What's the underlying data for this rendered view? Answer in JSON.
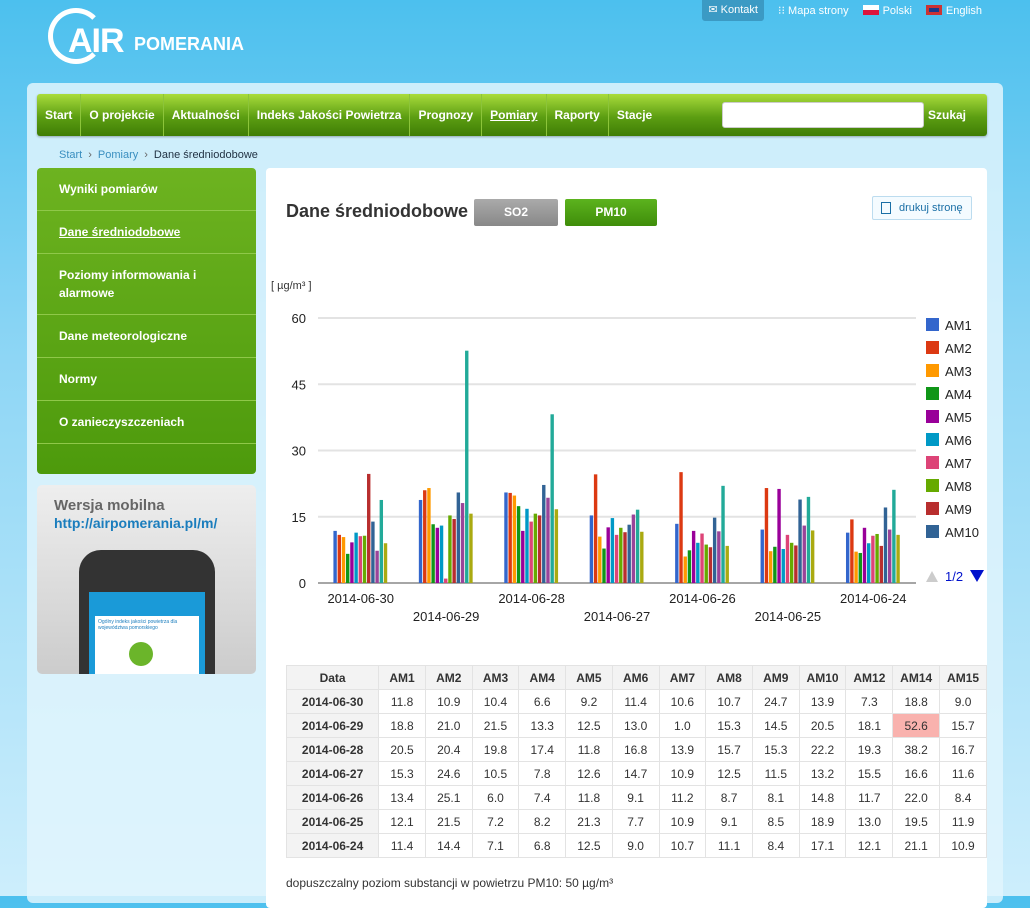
{
  "logo": {
    "text_air": "AIR",
    "text_pomerania": "POMERANIA",
    "reg": "®"
  },
  "toplinks": {
    "kontakt": "Kontakt",
    "mapa": "Mapa strony",
    "polski": "Polski",
    "english": "English"
  },
  "nav": {
    "items": [
      "Start",
      "O projekcie",
      "Aktualności",
      "Indeks Jakości Powietrza",
      "Prognozy",
      "Pomiary",
      "Raporty",
      "Stacje"
    ],
    "active": "Pomiary",
    "search_value": "",
    "search_button": "Szukaj"
  },
  "breadcrumb": [
    "Start",
    "Pomiary",
    "Dane średniodobowe"
  ],
  "sidebar": {
    "items": [
      "Wyniki pomiarów",
      "Dane średniodobowe",
      "Poziomy informowania i alarmowe",
      "Dane meteorologiczne",
      "Normy",
      "O zanieczyszczeniach"
    ],
    "active": "Dane średniodobowe"
  },
  "mobile": {
    "title": "Wersja mobilna",
    "url": "http://airpomerania.pl/m/",
    "screen_text": "Ogólny indeks jakości powietrza dla województwa pomorskiego"
  },
  "main": {
    "title": "Dane średniodobowe",
    "tabs": [
      "SO2",
      "PM10"
    ],
    "active_tab": "PM10",
    "print": "drukuj stronę",
    "unit": "[ µg/m³ ]",
    "note": "dopuszczalny poziom substancji w powietrzu PM10: 50 µg/m³",
    "legend_page": "1/2"
  },
  "chart_data": {
    "type": "bar",
    "ylabel": "[ µg/m³ ]",
    "ylim": [
      0,
      60
    ],
    "yticks": [
      0,
      15,
      30,
      45,
      60
    ],
    "grid": true,
    "legend": "right",
    "categories": [
      "2014-06-30",
      "2014-06-29",
      "2014-06-28",
      "2014-06-27",
      "2014-06-26",
      "2014-06-25",
      "2014-06-24"
    ],
    "series": [
      {
        "name": "AM1",
        "color": "#3366cc",
        "values": [
          11.8,
          18.8,
          20.5,
          15.3,
          13.4,
          12.1,
          11.4
        ]
      },
      {
        "name": "AM2",
        "color": "#dc3912",
        "values": [
          10.9,
          21.0,
          20.4,
          24.6,
          25.1,
          21.5,
          14.4
        ]
      },
      {
        "name": "AM3",
        "color": "#ff9900",
        "values": [
          10.4,
          21.5,
          19.8,
          10.5,
          6.0,
          7.2,
          7.1
        ]
      },
      {
        "name": "AM4",
        "color": "#109618",
        "values": [
          6.6,
          13.3,
          17.4,
          7.8,
          7.4,
          8.2,
          6.8
        ]
      },
      {
        "name": "AM5",
        "color": "#990099",
        "values": [
          9.2,
          12.5,
          11.8,
          12.6,
          11.8,
          21.3,
          12.5
        ]
      },
      {
        "name": "AM6",
        "color": "#0099c6",
        "values": [
          11.4,
          13.0,
          16.8,
          14.7,
          9.1,
          7.7,
          9.0
        ]
      },
      {
        "name": "AM7",
        "color": "#dd4477",
        "values": [
          10.6,
          1.0,
          13.9,
          10.9,
          11.2,
          10.9,
          10.7
        ]
      },
      {
        "name": "AM8",
        "color": "#66aa00",
        "values": [
          10.7,
          15.3,
          15.7,
          12.5,
          8.7,
          9.1,
          11.1
        ]
      },
      {
        "name": "AM9",
        "color": "#b82e2e",
        "values": [
          24.7,
          14.5,
          15.3,
          11.5,
          8.1,
          8.5,
          8.4
        ]
      },
      {
        "name": "AM10",
        "color": "#316395",
        "values": [
          13.9,
          20.5,
          22.2,
          13.2,
          14.8,
          18.9,
          17.1
        ]
      },
      {
        "name": "AM12",
        "color": "#994499",
        "values": [
          7.3,
          18.1,
          19.3,
          15.5,
          11.7,
          13.0,
          12.1
        ]
      },
      {
        "name": "AM14",
        "color": "#22aa99",
        "values": [
          18.8,
          52.6,
          38.2,
          16.6,
          22.0,
          19.5,
          21.1
        ]
      },
      {
        "name": "AM15",
        "color": "#aaaa11",
        "values": [
          9.0,
          15.7,
          16.7,
          11.6,
          8.4,
          11.9,
          10.9
        ]
      }
    ],
    "legend_visible": [
      "AM1",
      "AM2",
      "AM3",
      "AM4",
      "AM5",
      "AM6",
      "AM7",
      "AM8",
      "AM9",
      "AM10"
    ]
  },
  "table": {
    "headers": [
      "Data",
      "AM1",
      "AM2",
      "AM3",
      "AM4",
      "AM5",
      "AM6",
      "AM7",
      "AM8",
      "AM9",
      "AM10",
      "AM12",
      "AM14",
      "AM15"
    ],
    "exceed_limit": 50,
    "highlight_color": "#f9b2ae"
  }
}
